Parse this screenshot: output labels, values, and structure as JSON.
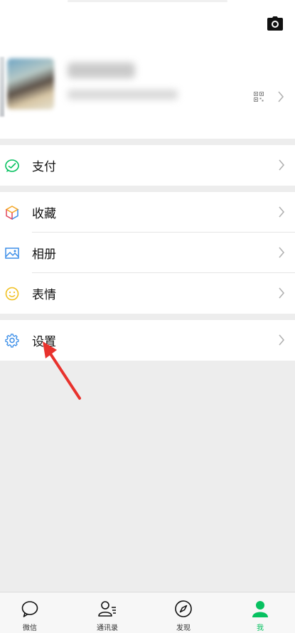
{
  "menu": {
    "pay_label": "支付",
    "favorites_label": "收藏",
    "album_label": "相册",
    "stickers_label": "表情",
    "settings_label": "设置"
  },
  "tabbar": {
    "items": [
      {
        "label": "微信",
        "icon": "chat-bubble-icon",
        "active": false
      },
      {
        "label": "通讯录",
        "icon": "contacts-icon",
        "active": false
      },
      {
        "label": "发现",
        "icon": "compass-icon",
        "active": false
      },
      {
        "label": "我",
        "icon": "person-icon",
        "active": true
      }
    ]
  },
  "colors": {
    "accent": "#07c160",
    "background": "#ededed",
    "annotation_arrow": "#e8322d"
  }
}
